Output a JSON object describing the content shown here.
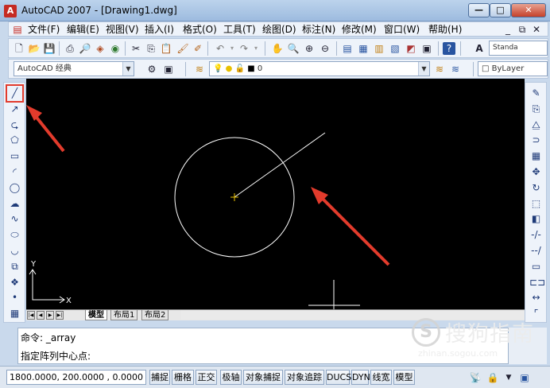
{
  "window": {
    "title": "AutoCAD 2007 - [Drawing1.dwg]",
    "app_icon": "A",
    "minimize": "—",
    "maximize": "□",
    "close": "✕"
  },
  "menu": {
    "items": [
      "文件(F)",
      "编辑(E)",
      "视图(V)",
      "插入(I)",
      "格式(O)",
      "工具(T)",
      "绘图(D)",
      "标注(N)",
      "修改(M)",
      "窗口(W)",
      "帮助(H)"
    ],
    "doc_controls": [
      "_",
      "⧉",
      "✕"
    ]
  },
  "toolbar1": {
    "text_style_combo": "Standa"
  },
  "toolbar2": {
    "workspace": "AutoCAD 经典",
    "layer": "0",
    "color": "ByLayer"
  },
  "left_toolbar": {
    "tools": [
      {
        "name": "line-icon",
        "glyph": "╱",
        "highlighted": true
      },
      {
        "name": "construction-line-icon",
        "glyph": "↗"
      },
      {
        "name": "polyline-icon",
        "glyph": "⮎"
      },
      {
        "name": "polygon-icon",
        "glyph": "⬠"
      },
      {
        "name": "rectangle-icon",
        "glyph": "▭"
      },
      {
        "name": "arc-icon",
        "glyph": "◜"
      },
      {
        "name": "circle-icon",
        "glyph": "◯"
      },
      {
        "name": "revision-cloud-icon",
        "glyph": "☁"
      },
      {
        "name": "spline-icon",
        "glyph": "∿"
      },
      {
        "name": "ellipse-icon",
        "glyph": "⬭"
      },
      {
        "name": "ellipse-arc-icon",
        "glyph": "◡"
      },
      {
        "name": "insert-block-icon",
        "glyph": "⧉"
      },
      {
        "name": "make-block-icon",
        "glyph": "❖"
      },
      {
        "name": "point-icon",
        "glyph": "•"
      },
      {
        "name": "hatch-icon",
        "glyph": "▦"
      }
    ]
  },
  "right_toolbar": {
    "tools": [
      {
        "name": "erase-icon",
        "glyph": "✎"
      },
      {
        "name": "copy-icon",
        "glyph": "⎘"
      },
      {
        "name": "mirror-icon",
        "glyph": "⧋"
      },
      {
        "name": "offset-icon",
        "glyph": "⊃"
      },
      {
        "name": "array-icon",
        "glyph": "▦"
      },
      {
        "name": "move-icon",
        "glyph": "✥"
      },
      {
        "name": "rotate-icon",
        "glyph": "↻"
      },
      {
        "name": "scale-icon",
        "glyph": "⬚"
      },
      {
        "name": "stretch-icon",
        "glyph": "◧"
      },
      {
        "name": "trim-icon",
        "glyph": "-/-"
      },
      {
        "name": "extend-icon",
        "glyph": "--/"
      },
      {
        "name": "break-at-point-icon",
        "glyph": "▭"
      },
      {
        "name": "break-icon",
        "glyph": "⊏⊐"
      },
      {
        "name": "join-icon",
        "glyph": "↔"
      },
      {
        "name": "chamfer-icon",
        "glyph": "⌜"
      }
    ]
  },
  "canvas": {
    "background": "#000000",
    "ucs_x": "X",
    "ucs_y": "Y",
    "annotation_color": "#e23b2c",
    "tool_highlight_color": "#e23b2c"
  },
  "layout_tabs": {
    "nav": [
      "|◀",
      "◀",
      "▶",
      "▶|"
    ],
    "tabs": [
      "模型",
      "布局1",
      "布局2"
    ]
  },
  "command": {
    "line1": "命令: _array",
    "line2": "指定阵列中心点:"
  },
  "status": {
    "coords": "1800.0000, 200.0000 , 0.0000",
    "toggles": [
      "捕捉",
      "栅格",
      "正交",
      "极轴",
      "对象捕捉",
      "对象追踪",
      "DUCS",
      "DYN",
      "线宽",
      "模型"
    ]
  },
  "watermark": {
    "logo_letter": "S",
    "text": "搜狗指南",
    "url": "zhinan.sogou.com"
  }
}
